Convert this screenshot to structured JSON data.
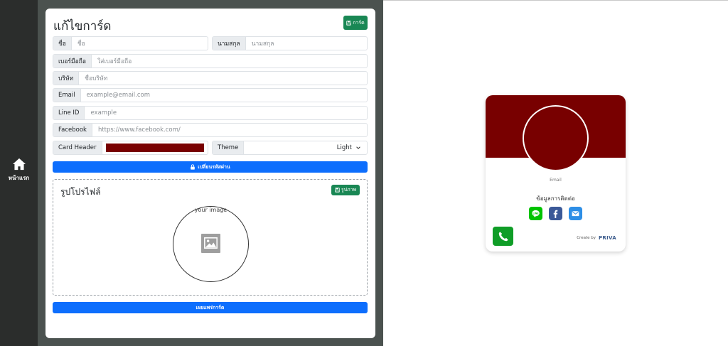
{
  "sidebar": {
    "home_label": "หน้าแรก"
  },
  "editor": {
    "title": "แก้ไขการ์ด",
    "card_button": "การ์ด",
    "first_name": {
      "label": "ชื่อ",
      "placeholder": "ชื่อ"
    },
    "last_name": {
      "label": "นามสกุล",
      "placeholder": "นามสกุล"
    },
    "phone": {
      "label": "เบอร์มือถือ",
      "placeholder": "ใส่เบอร์มือถือ"
    },
    "company": {
      "label": "บริษัท",
      "placeholder": "ชื่อบริษัท"
    },
    "email": {
      "label": "Email",
      "placeholder": "example@email.com"
    },
    "line": {
      "label": "Line ID",
      "placeholder": "example"
    },
    "facebook": {
      "label": "Facebook",
      "placeholder": "https://www.facebook.com/"
    },
    "card_header": {
      "label": "Card Header",
      "color": "#780000"
    },
    "theme": {
      "label": "Theme",
      "value": "Light"
    },
    "change_password_button": "เปลี่ยนรหัสผ่าน",
    "profile": {
      "title": "รูปโปรไฟล์",
      "image_button": "รูปภาพ",
      "image_text": "your image"
    },
    "publish_button": "เผยแพร่การ์ด"
  },
  "preview": {
    "header_color": "#780000",
    "email_label": "Email",
    "contact_title": "ข้อมูลการติดต่อ",
    "social_icons": [
      "line-icon",
      "facebook-icon",
      "email-icon"
    ],
    "created_by": "Create by",
    "logo_text": "PRIVA"
  },
  "colors": {
    "sidebar": "#2b2d2c",
    "green": "#198754",
    "blue": "#0d6efd",
    "phone": "#0f9d27"
  }
}
